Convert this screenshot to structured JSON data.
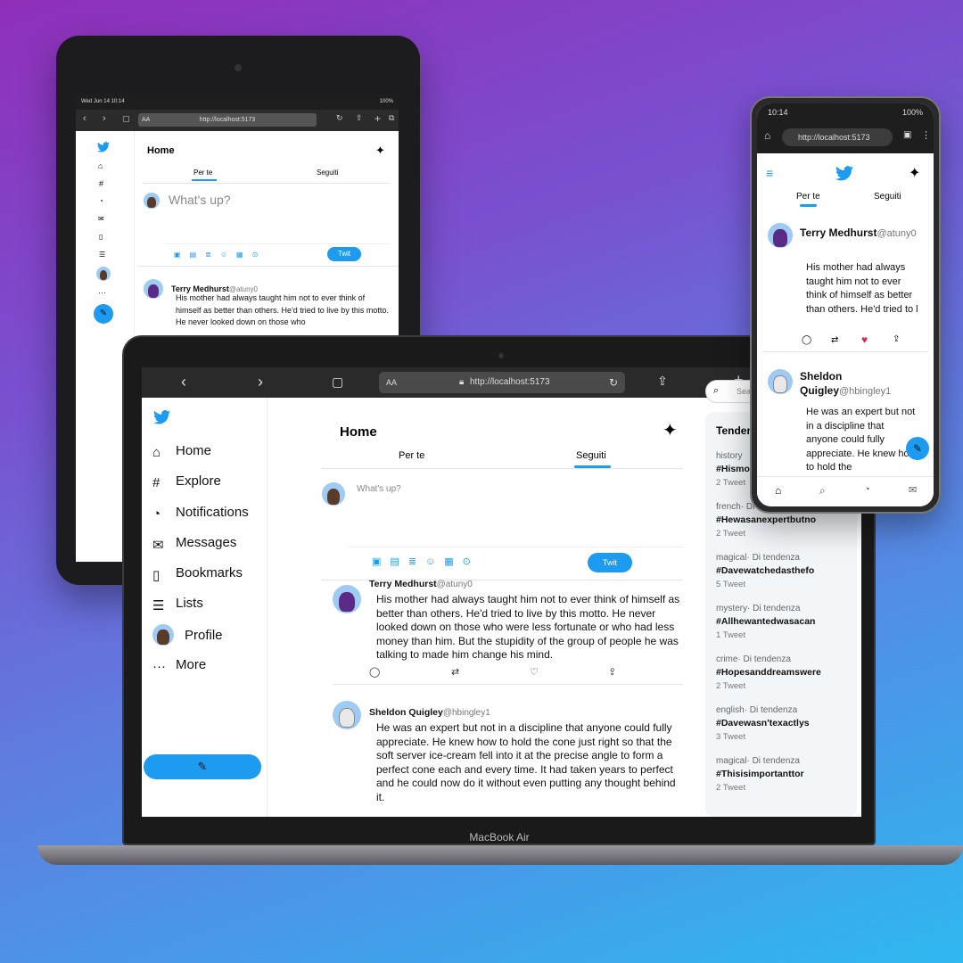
{
  "tablet": {
    "status_left": "Wed Jun 14  10:14",
    "status_right": "100%",
    "url": "http://localhost:5173",
    "aa": "AA",
    "title": "Home",
    "tabs": [
      "Per te",
      "Seguiti"
    ],
    "compose_placeholder": "What's up?",
    "tweet_button": "Twit",
    "tweet": {
      "name": "Terry Medhurst",
      "handle": "@atuny0",
      "text": "His mother had always taught him not to ever think of himself as better than others. He'd tried to live by this motto. He never looked down on those who"
    }
  },
  "laptop": {
    "label": "MacBook Air",
    "aa": "AA",
    "url": "http://localhost:5173",
    "nav": [
      {
        "label": "Home",
        "icon": "home-icon"
      },
      {
        "label": "Explore",
        "icon": "hash-icon"
      },
      {
        "label": "Notifications",
        "icon": "bell-icon"
      },
      {
        "label": "Messages",
        "icon": "mail-icon"
      },
      {
        "label": "Bookmarks",
        "icon": "bookmark-icon"
      },
      {
        "label": "Lists",
        "icon": "list-icon"
      },
      {
        "label": "Profile",
        "icon": "avatar"
      },
      {
        "label": "More",
        "icon": "dots-icon"
      }
    ],
    "title": "Home",
    "tabs": [
      "Per te",
      "Seguiti"
    ],
    "compose_placeholder": "What's up?",
    "tweet_button": "Twit",
    "search_placeholder": "Search",
    "trends_title": "Tendenze",
    "tweets": [
      {
        "name": "Terry Medhurst",
        "handle": "@atuny0",
        "text": "His mother had always taught him not to ever think of himself as better than others. He'd tried to live by this motto. He never looked down on those who were less fortunate or who had less money than him. But the stupidity of the group of people he was talking to made him change his mind."
      },
      {
        "name": "Sheldon Quigley",
        "handle": "@hbingley1",
        "text": "He was an expert but not in a discipline that anyone could fully appreciate. He knew how to hold the cone just right so that the soft server ice-cream fell into it at the precise angle to form a perfect cone each and every time. It had taken years to perfect and he could now do it without even putting any thought behind it."
      }
    ],
    "trends": [
      {
        "category": "history",
        "tag": "#Hismotherhad",
        "count": "2 Tweet"
      },
      {
        "category": "french· Di tendenza",
        "tag": "#Hewasanexpertbutno",
        "count": "2 Tweet"
      },
      {
        "category": "magical· Di tendenza",
        "tag": "#Davewatchedasthefo",
        "count": "5 Tweet"
      },
      {
        "category": "mystery· Di tendenza",
        "tag": "#Allhewantedwasacan",
        "count": "1 Tweet"
      },
      {
        "category": "crime· Di tendenza",
        "tag": "#Hopesanddreamswere",
        "count": "2 Tweet"
      },
      {
        "category": "english· Di tendenza",
        "tag": "#Davewasn'texactlys",
        "count": "3 Tweet"
      },
      {
        "category": "magical· Di tendenza",
        "tag": "#Thisisimportanttor",
        "count": "2 Tweet"
      }
    ]
  },
  "phone": {
    "time": "10:14",
    "battery": "100%",
    "url": "http://localhost:5173",
    "tabs": [
      "Per te",
      "Seguiti"
    ],
    "tweets": [
      {
        "name": "Terry Medhurst",
        "handle": "@atuny0",
        "text": "His mother had always taught him not to ever think of himself as better than others. He'd tried to l"
      },
      {
        "name": "Sheldon Quigley",
        "handle": "@hbingley1",
        "text": "He was an expert but not in a discipline that anyone could fully appreciate. He knew how to hold the"
      }
    ]
  },
  "colors": {
    "accent": "#1d9bf0",
    "like": "#e0245e"
  }
}
